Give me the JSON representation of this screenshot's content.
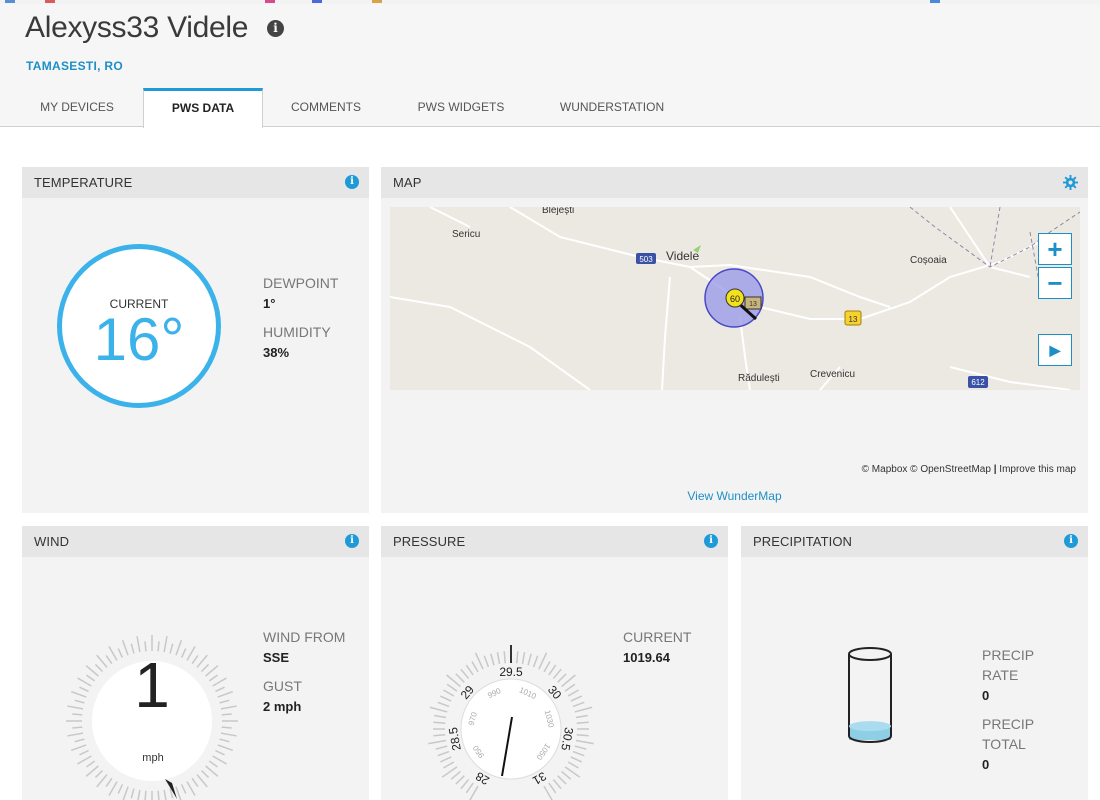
{
  "station": {
    "name": "Alexyss33 Videle",
    "info_icon": "i",
    "location": "TAMASESTI, RO"
  },
  "tabs": [
    {
      "label": "MY DEVICES",
      "active": false
    },
    {
      "label": "PWS DATA",
      "active": true
    },
    {
      "label": "COMMENTS",
      "active": false
    },
    {
      "label": "PWS WIDGETS",
      "active": false
    },
    {
      "label": "WUNDERSTATION",
      "active": false
    }
  ],
  "temperature": {
    "title": "TEMPERATURE",
    "current_label": "CURRENT",
    "value": "16°",
    "dewpoint_label": "DEWPOINT",
    "dewpoint_value": "1°",
    "humidity_label": "HUMIDITY",
    "humidity_value": "38%"
  },
  "map": {
    "title": "MAP",
    "places": [
      "Blejești",
      "Sericu",
      "Videle",
      "Coșoaia",
      "Rădulești",
      "Crevenicu"
    ],
    "road_labels": [
      "503",
      "13",
      "13",
      "612"
    ],
    "marker_value": "60",
    "zoom_in": "+",
    "zoom_out": "−",
    "play": "▶",
    "attribution_mapbox": "© Mapbox",
    "attribution_osm": "© OpenStreetMap",
    "attribution_sep": "|",
    "attribution_improve": "Improve this map",
    "view_link": "View WunderMap"
  },
  "wind": {
    "title": "WIND",
    "speed": "1",
    "unit": "mph",
    "from_label": "WIND FROM",
    "from_value": "SSE",
    "gust_label": "GUST",
    "gust_value": "2 mph"
  },
  "pressure": {
    "title": "PRESSURE",
    "current_label": "CURRENT",
    "current_value": "1019.64",
    "outer_ticks": [
      "28",
      "28.5",
      "29",
      "29.5",
      "30",
      "30.5",
      "31"
    ],
    "inner_ticks": [
      "950",
      "970",
      "990",
      "1010",
      "1030",
      "1050"
    ]
  },
  "precipitation": {
    "title": "PRECIPITATION",
    "rate_label_1": "PRECIP",
    "rate_label_2": "RATE",
    "rate_value": "0",
    "total_label_1": "PRECIP",
    "total_label_2": "TOTAL",
    "total_value": "0",
    "fill_fraction": 0.12
  },
  "colors": {
    "accent_blue": "#1e9ad6",
    "temp_ring": "#3bb2ea",
    "precip_fill": "#8ecfe6"
  }
}
